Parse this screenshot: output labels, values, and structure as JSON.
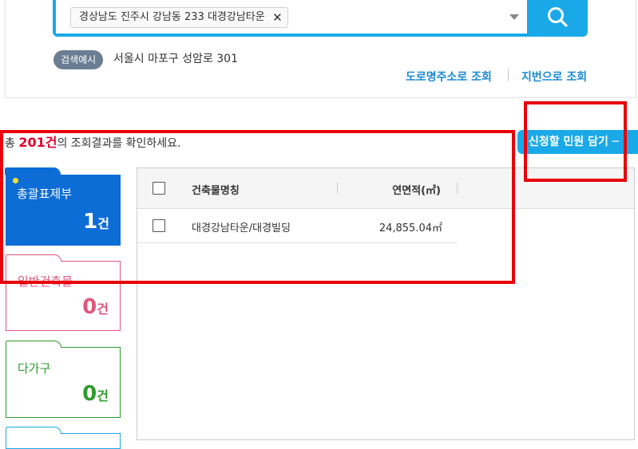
{
  "search": {
    "address_chip": "경상남도 진주시 강남동 233 대경강남타운",
    "remove_glyph": "✕",
    "example_badge": "검색예시",
    "example_text": "서울시 마포구 성암로 301",
    "links": {
      "road": "도로명주소로 조회",
      "jibun": "지번으로 조회"
    }
  },
  "results": {
    "prefix": "총 ",
    "count": "201건",
    "suffix": "의 조회결과를 확인하세요.",
    "cart_button": "신청할 민원 담기 ─"
  },
  "categories": [
    {
      "label": "총괄표제부",
      "count": "1",
      "unit": "건"
    },
    {
      "label": "일반건축물",
      "count": "0",
      "unit": "건"
    },
    {
      "label": "다가구",
      "count": "0",
      "unit": "건"
    }
  ],
  "table": {
    "headers": {
      "name": "건축물명칭",
      "area": "연면적(㎡)"
    },
    "rows": [
      {
        "name": "대경강남타운/대경빌딩",
        "area": "24,855.04㎡"
      }
    ]
  },
  "colors": {
    "accent": "#1aa9e8",
    "highlight": "#e8000b",
    "category_total": "#0d6dd6",
    "category_general": "#e0557c",
    "category_multi": "#2e9b2e"
  },
  "icons": [
    "search-icon",
    "dropdown-arrow-icon",
    "close-icon",
    "checkbox-icon"
  ]
}
